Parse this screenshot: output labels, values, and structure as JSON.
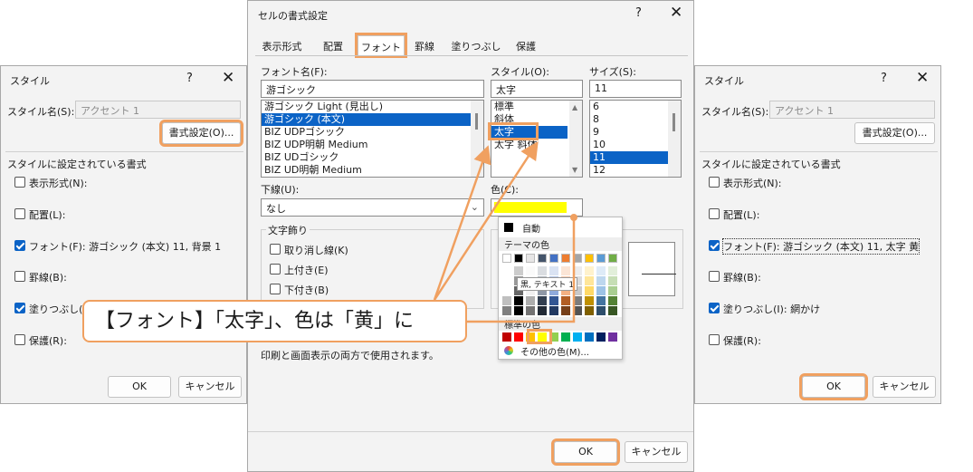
{
  "style_left": {
    "title": "スタイル",
    "help": "?",
    "close": "✕",
    "style_name_label": "スタイル名(S):",
    "style_name_value": "アクセント 1",
    "format_button": "書式設定(O)...",
    "section_label": "スタイルに設定されている書式",
    "items": [
      {
        "label": "表示形式(N):",
        "checked": false
      },
      {
        "label": "配置(L):",
        "checked": false
      },
      {
        "label": "フォント(F): 游ゴシック (本文) 11, 背景 1",
        "checked": true
      },
      {
        "label": "罫線(B):",
        "checked": false
      },
      {
        "label": "塗りつぶし(I)",
        "checked": true
      },
      {
        "label": "保護(R):",
        "checked": false
      }
    ],
    "ok": "OK",
    "cancel": "キャンセル"
  },
  "format": {
    "title": "セルの書式設定",
    "help": "?",
    "close": "✕",
    "tabs": [
      "表示形式",
      "配置",
      "フォント",
      "罫線",
      "塗りつぶし",
      "保護"
    ],
    "font_label": "フォント名(F):",
    "font_value": "游ゴシック",
    "fonts": [
      "游ゴシック Light (見出し)",
      "游ゴシック (本文)",
      "BIZ UDPゴシック",
      "BIZ UDP明朝 Medium",
      "BIZ UDゴシック",
      "BIZ UD明朝 Medium"
    ],
    "style_label": "スタイル(O):",
    "style_value": "太字",
    "styles": [
      "標準",
      "斜体",
      "太字",
      "太字 斜体"
    ],
    "size_label": "サイズ(S):",
    "size_value": "11",
    "sizes": [
      "6",
      "8",
      "9",
      "10",
      "11",
      "12"
    ],
    "underline_label": "下線(U):",
    "underline_value": "なし",
    "color_label": "色(C):",
    "effects_label": "文字飾り",
    "effects": [
      "取り消し線(K)",
      "上付き(E)",
      "下付き(B)"
    ],
    "note": "印刷と画面表示の両方で使用されます。",
    "ok": "OK",
    "cancel": "キャンセル",
    "palette": {
      "auto": "自動",
      "theme_label": "テーマの色",
      "tooltip": "黒, テキスト 1",
      "standard_label": "標準の色",
      "more": "その他の色(M)..."
    },
    "colors": {
      "theme_top": [
        "#ffffff",
        "#000000",
        "#e7e6e6",
        "#44546a",
        "#4472c4",
        "#ed7d31",
        "#a5a5a5",
        "#ffc000",
        "#5b9bd5",
        "#70ad47"
      ],
      "standard": [
        "#c00000",
        "#ff0000",
        "#ffc000",
        "#ffff00",
        "#92d050",
        "#00b050",
        "#00b0f0",
        "#0070c0",
        "#002060",
        "#7030a0"
      ],
      "yellow": "#ffff00",
      "accent": "#f0a060",
      "selection": "#0b63c6"
    }
  },
  "style_right": {
    "title": "スタイル",
    "help": "?",
    "close": "✕",
    "style_name_label": "スタイル名(S):",
    "style_name_value": "アクセント 1",
    "format_button": "書式設定(O)...",
    "section_label": "スタイルに設定されている書式",
    "items": [
      {
        "label": "表示形式(N):",
        "checked": false
      },
      {
        "label": "配置(L):",
        "checked": false
      },
      {
        "label": "フォント(F): 游ゴシック (本文) 11, 太字 黄",
        "checked": true
      },
      {
        "label": "罫線(B):",
        "checked": false
      },
      {
        "label": "塗りつぶし(I): 網かけ",
        "checked": true
      },
      {
        "label": "保護(R):",
        "checked": false
      }
    ],
    "ok": "OK",
    "cancel": "キャンセル"
  },
  "callout": "【フォント】「太字」、色は「黄」に"
}
